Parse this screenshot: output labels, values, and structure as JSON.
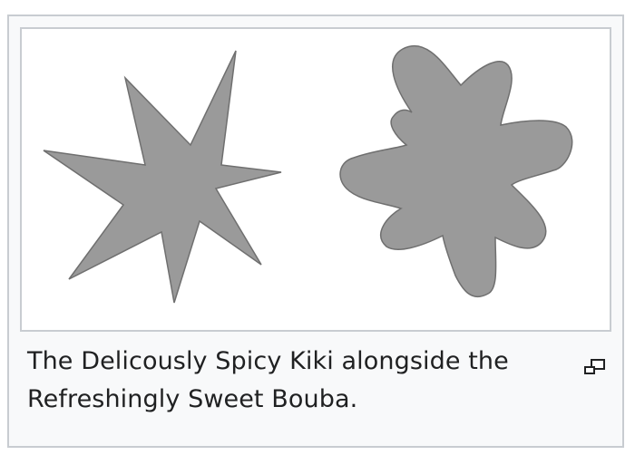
{
  "figure": {
    "caption": "The Delicously Spicy Kiki alongside the Refreshingly Sweet Bouba.",
    "shapes": [
      {
        "name": "Kiki",
        "type": "spiky-star"
      },
      {
        "name": "Bouba",
        "type": "rounded-blob"
      }
    ],
    "enlarge_icon": "magnify-clip-icon"
  },
  "colors": {
    "frame_background": "#f8f9fa",
    "frame_border": "#c8ccd1",
    "image_background": "#ffffff",
    "shape_fill": "#9a9a9a",
    "shape_stroke": "#6f6f6f",
    "caption_text": "#202122"
  }
}
